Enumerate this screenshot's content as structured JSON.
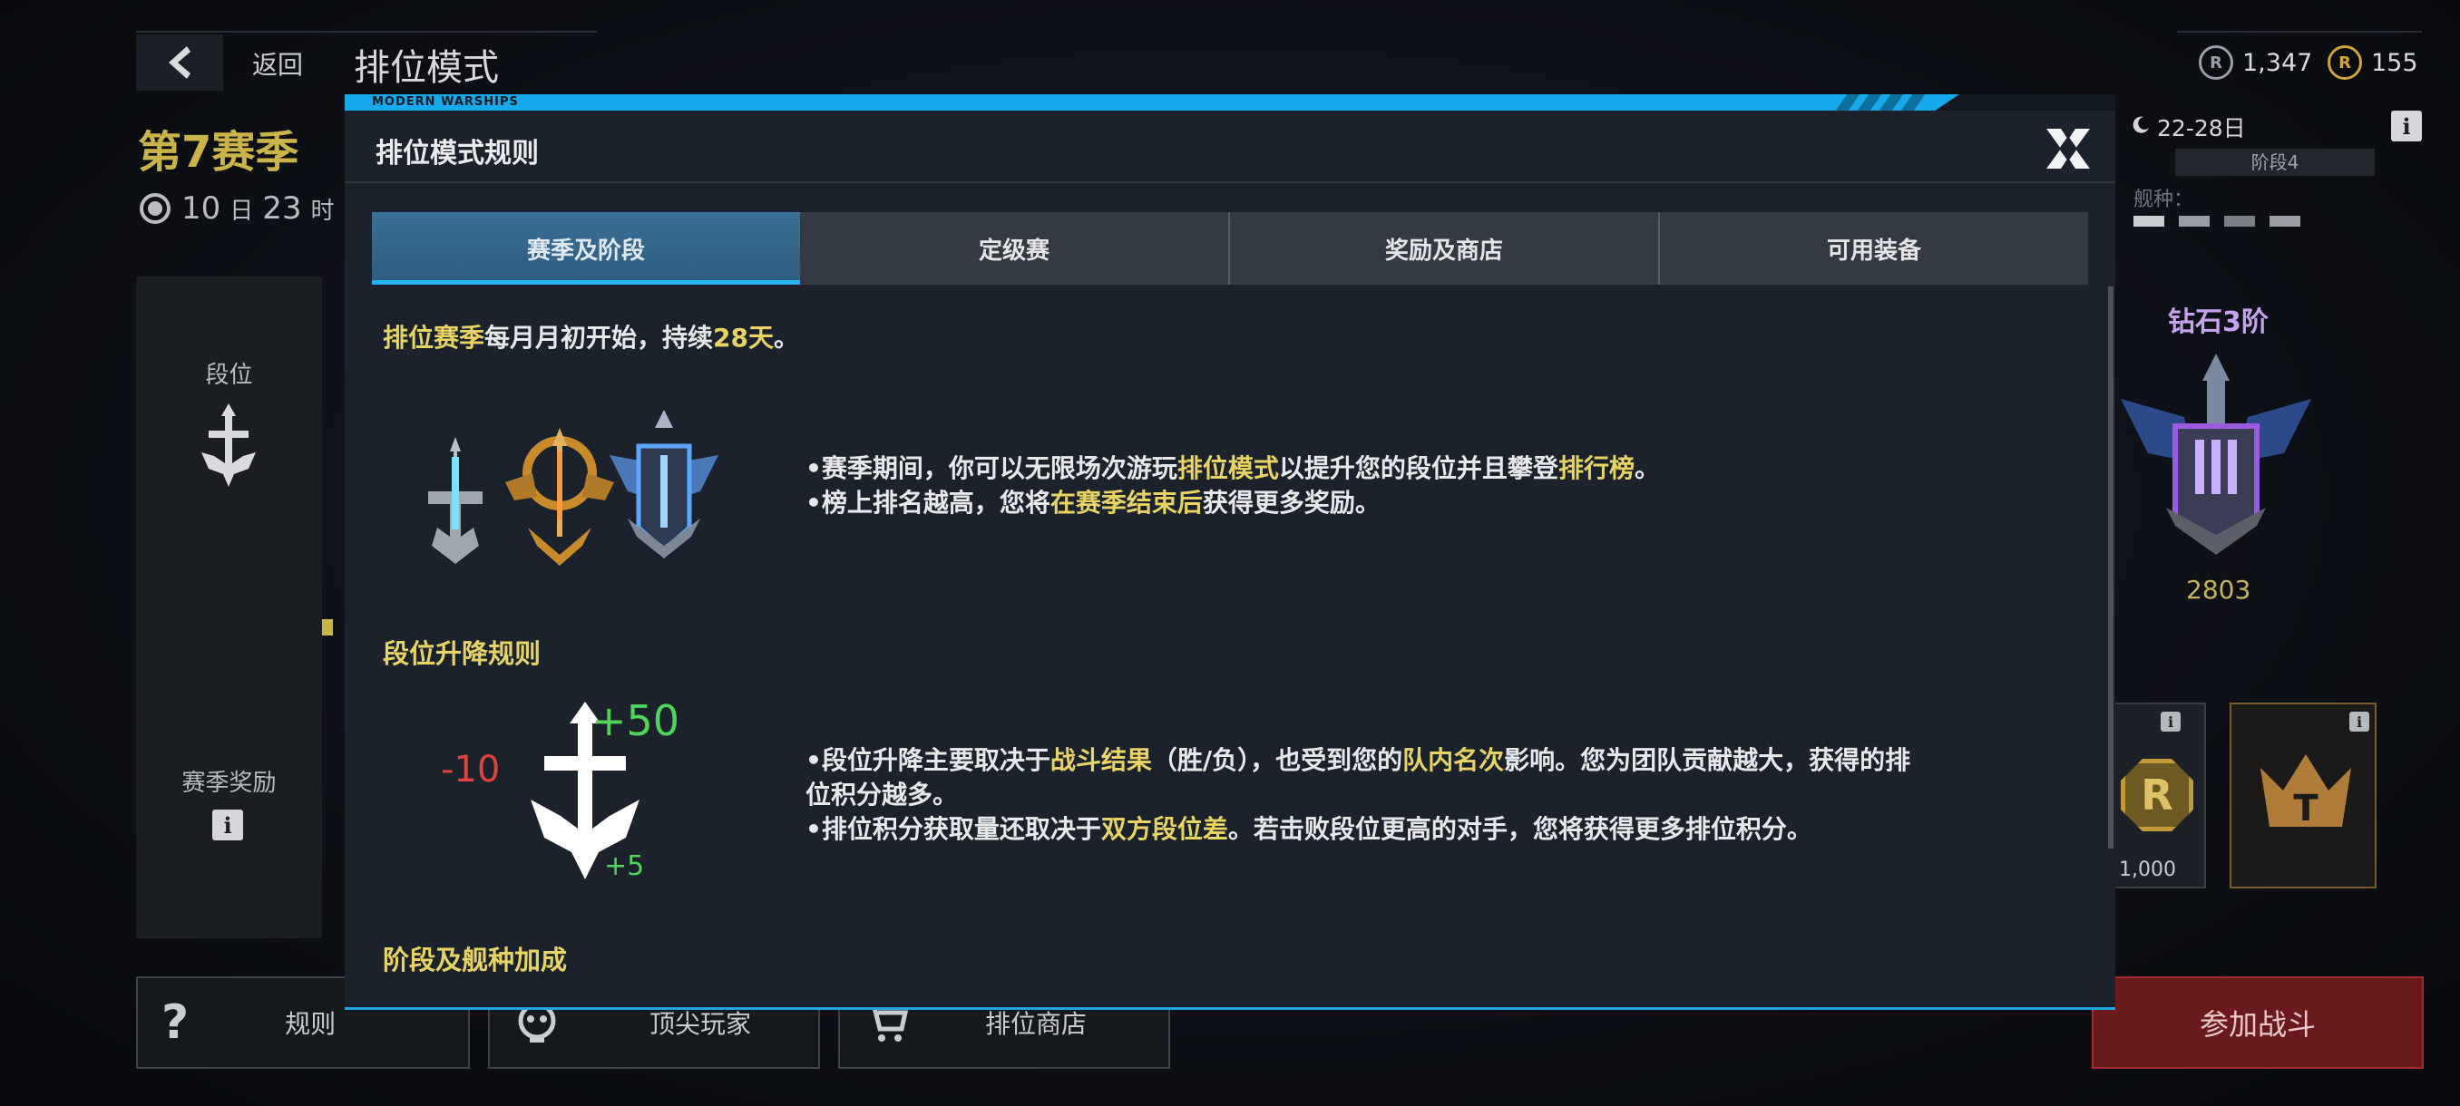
{
  "header": {
    "back_label": "返回",
    "title": "排位模式",
    "currency": [
      {
        "icon": "r-coin-icon",
        "value": "1,347",
        "color": "#9aa0a6"
      },
      {
        "icon": "gold-coin-icon",
        "value": "155",
        "color": "#d1a43a"
      }
    ]
  },
  "season": {
    "name": "第7赛季",
    "timer_days": "10",
    "timer_day_unit": "日",
    "timer_hours": "23",
    "timer_hour_unit": "时"
  },
  "left_panel": {
    "rank_label": "段位",
    "season_reward_label": "赛季奖励"
  },
  "right_panel": {
    "date_range": "22-28日",
    "phase": "阶段4",
    "ship_type_label": "舰种：",
    "rank_name": "钻石3阶",
    "rank_score": "2803",
    "reward_value": "1,000"
  },
  "bottom_bar": {
    "rules": "规则",
    "top_players": "顶尖玩家",
    "shop": "排位商店",
    "join_battle": "参加战斗"
  },
  "modal": {
    "brand": "MODERN WARSHIPS",
    "title": "排位模式规则",
    "tabs": [
      {
        "label": "赛季及阶段",
        "active": true
      },
      {
        "label": "定级赛",
        "active": false
      },
      {
        "label": "奖励及商店",
        "active": false
      },
      {
        "label": "可用装备",
        "active": false
      }
    ],
    "intro": {
      "hl1": "排位赛季",
      "t1": "每月月初开始，持续",
      "hl2": "28天",
      "t2": "。"
    },
    "season_bullets": {
      "b1_pre": "•赛季期间，你可以无限场次游玩",
      "b1_hl1": "排位模式",
      "b1_mid": "以提升您的段位并且攀登",
      "b1_hl2": "排行榜",
      "b1_end": "。",
      "b2_pre": "•榜上排名越高，您将",
      "b2_hl": "在赛季结束后",
      "b2_end": "获得更多奖励。"
    },
    "rank_rules": {
      "title": "段位升降规则",
      "plus50": "+50",
      "minus10": "-10",
      "plus5": "+5",
      "b1_pre": "•段位升降主要取决于",
      "b1_hl1": "战斗结果",
      "b1_mid": "（胜/负），也受到您的",
      "b1_hl2": "队内名次",
      "b1_end": "影响。您为团队贡献越大，获得的排",
      "b1_line2": "位积分越多。",
      "b2_pre": "•排位积分获取量还取决于",
      "b2_hl": "双方段位差",
      "b2_end": "。若击败段位更高的对手，您将获得更多排位积分。"
    },
    "phase_title": "阶段及舰种加成"
  },
  "colors": {
    "accent_cyan": "#18a9ea",
    "highlight_yellow": "#e7d465",
    "plus_green": "#4fd65a",
    "minus_red": "#e0423c"
  }
}
